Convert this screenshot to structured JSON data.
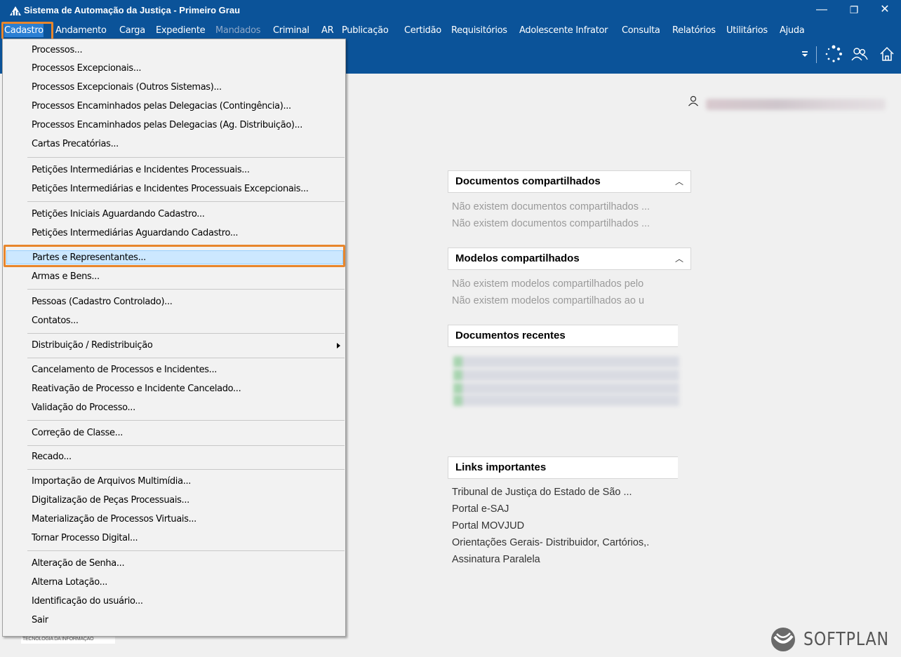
{
  "window": {
    "title": "Sistema de Automação da Justiça - Primeiro Grau",
    "minimize": "—",
    "restore": "❐",
    "close": "✕"
  },
  "menubar": [
    {
      "label": "Cadastro",
      "state": "active"
    },
    {
      "label": "Andamento"
    },
    {
      "label": "Carga"
    },
    {
      "label": "Expediente"
    },
    {
      "label": "Mandados",
      "state": "disabled"
    },
    {
      "label": "Criminal"
    },
    {
      "label": "AR"
    },
    {
      "label": "Publicação"
    },
    {
      "label": "Certidão"
    },
    {
      "label": "Requisitórios"
    },
    {
      "label": "Adolescente Infrator"
    },
    {
      "label": "Consulta"
    },
    {
      "label": "Relatórios"
    },
    {
      "label": "Utilitários"
    },
    {
      "label": "Ajuda"
    }
  ],
  "dropdown": [
    {
      "label": "Processos..."
    },
    {
      "label": "Processos Excepcionais..."
    },
    {
      "label": "Processos Excepcionais (Outros Sistemas)..."
    },
    {
      "label": "Processos Encaminhados pelas Delegacias (Contingência)..."
    },
    {
      "label": "Processos Encaminhados pelas Delegacias (Ag. Distribuição)..."
    },
    {
      "label": "Cartas Precatórias..."
    },
    {
      "label": "Petições Intermediárias e Incidentes Processuais..."
    },
    {
      "label": "Petições Intermediárias e Incidentes Processuais Excepcionais..."
    },
    {
      "label": "Petições Iniciais Aguardando Cadastro..."
    },
    {
      "label": "Petições Intermediárias Aguardando Cadastro..."
    },
    {
      "label": "Partes e Representantes...",
      "selected": true
    },
    {
      "label": "Armas e Bens..."
    },
    {
      "label": "Pessoas (Cadastro Controlado)..."
    },
    {
      "label": "Contatos..."
    },
    {
      "label": "Distribuição / Redistribuição",
      "submenu": true
    },
    {
      "label": "Cancelamento de Processos e Incidentes..."
    },
    {
      "label": "Reativação de Processo e Incidente Cancelado..."
    },
    {
      "label": "Validação do Processo..."
    },
    {
      "label": "Correção de Classe..."
    },
    {
      "label": "Recado..."
    },
    {
      "label": "Importação de Arquivos Multimídia..."
    },
    {
      "label": "Digitalização de Peças Processuais..."
    },
    {
      "label": "Materialização de Processos Virtuais..."
    },
    {
      "label": "Tornar Processo Digital..."
    },
    {
      "label": "Alteração de Senha..."
    },
    {
      "label": "Alterna Lotação..."
    },
    {
      "label": "Identificação do usuário..."
    },
    {
      "label": "Sair"
    }
  ],
  "panels": {
    "docs_shared": {
      "title": "Documentos compartilhados",
      "lines": [
        "Não existem documentos compartilhados ...",
        "Não existem documentos compartilhados ..."
      ]
    },
    "models_shared": {
      "title": "Modelos compartilhados",
      "lines": [
        "Não existem modelos compartilhados pelo",
        "Não existem modelos compartilhados ao u"
      ]
    },
    "recent_docs": {
      "title": "Documentos recentes"
    },
    "links": {
      "title": "Links importantes",
      "items": [
        "Tribunal de Justiça do Estado de São ...",
        "Portal e-SAJ",
        "Portal MOVJUD",
        "Orientações Gerais- Distribuidor, Cartórios,.",
        "Assinatura Paralela"
      ]
    }
  },
  "footer_tag": "TECNOLOGIA DA INFORMAÇÃO",
  "brand": "SOFTPLAN",
  "icons": {
    "app": "justice-building-icon",
    "toolbar": [
      "filter-dropdown-icon",
      "loading-spinner-icon",
      "users-icon",
      "home-icon"
    ],
    "user": "user-icon",
    "brand": "softplan-logo-icon"
  },
  "colors": {
    "titlebar": "#0b5399",
    "highlight": "#e8862c",
    "selected_item": "#cce8ff"
  }
}
